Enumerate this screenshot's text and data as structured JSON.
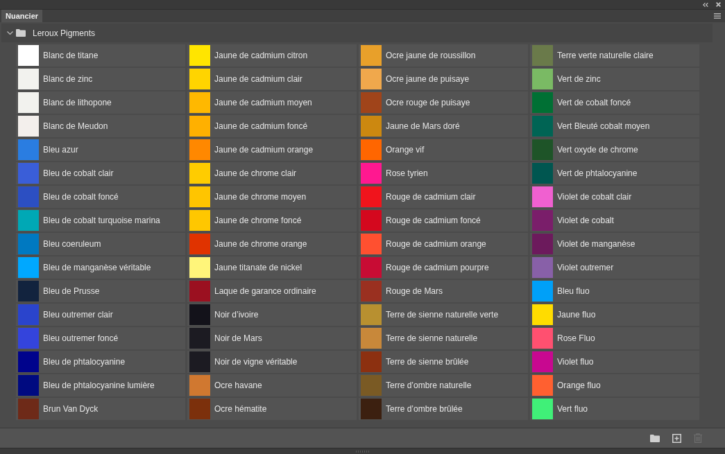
{
  "tabs": [
    {
      "label": "Nuancier",
      "selected": true
    }
  ],
  "group": {
    "name": "Leroux Pigments",
    "expanded": true,
    "swatches": [
      {
        "name": "Blanc de titane",
        "color": "#ffffff"
      },
      {
        "name": "Blanc de zinc",
        "color": "#f2f2ee"
      },
      {
        "name": "Blanc de lithopone",
        "color": "#f2f2ee"
      },
      {
        "name": "Blanc de Meudon",
        "color": "#f3efec"
      },
      {
        "name": "Bleu azur",
        "color": "#2a7de1"
      },
      {
        "name": "Bleu de cobalt clair",
        "color": "#3a5ed8"
      },
      {
        "name": "Bleu de cobalt foncé",
        "color": "#2c4fc2"
      },
      {
        "name": "Bleu de cobalt turquoise marina",
        "color": "#00a8b5"
      },
      {
        "name": "Bleu coeruleum",
        "color": "#0079c1"
      },
      {
        "name": "Bleu de manganèse véritable",
        "color": "#00a8ff"
      },
      {
        "name": "Bleu de Prusse",
        "color": "#12233e"
      },
      {
        "name": "Bleu outremer clair",
        "color": "#2a44cc"
      },
      {
        "name": "Bleu outremer foncé",
        "color": "#3444dc"
      },
      {
        "name": "Bleu de phtalocyanine",
        "color": "#00038c"
      },
      {
        "name": "Bleu de phtalocyanine lumière",
        "color": "#000a80"
      },
      {
        "name": "Brun Van Dyck",
        "color": "#6e2a18"
      },
      {
        "name": "Jaune de cadmium citron",
        "color": "#ffe500"
      },
      {
        "name": "Jaune de cadmium clair",
        "color": "#ffd400"
      },
      {
        "name": "Jaune de cadmium moyen",
        "color": "#ffb800"
      },
      {
        "name": "Jaune de cadmium foncé",
        "color": "#ffb000"
      },
      {
        "name": "Jaune de cadmium orange",
        "color": "#ff8800"
      },
      {
        "name": "Jaune de chrome clair",
        "color": "#ffcc00"
      },
      {
        "name": "Jaune de chrome moyen",
        "color": "#ffc500"
      },
      {
        "name": "Jaune de chrome foncé",
        "color": "#ffc700"
      },
      {
        "name": "Jaune de chrome orange",
        "color": "#e03300"
      },
      {
        "name": "Jaune titanate de nickel",
        "color": "#fff57a"
      },
      {
        "name": "Laque de garance ordinaire",
        "color": "#9b1020"
      },
      {
        "name": "Noir d’ivoire",
        "color": "#13121a"
      },
      {
        "name": "Noir de Mars",
        "color": "#1c1b22"
      },
      {
        "name": "Noir de vigne véritable",
        "color": "#1c1b22"
      },
      {
        "name": "Ocre havane",
        "color": "#d07830"
      },
      {
        "name": "Ocre hématite",
        "color": "#7c300c"
      },
      {
        "name": "Ocre jaune de roussillon",
        "color": "#e8a02a"
      },
      {
        "name": "Ocre jaune de puisaye",
        "color": "#f0a84c"
      },
      {
        "name": "Ocre rouge de puisaye",
        "color": "#a0441a"
      },
      {
        "name": "Jaune de Mars doré",
        "color": "#cc8810"
      },
      {
        "name": "Orange vif",
        "color": "#ff6600"
      },
      {
        "name": "Rose tyrien",
        "color": "#ff1890"
      },
      {
        "name": "Rouge de cadmium clair",
        "color": "#f0141c"
      },
      {
        "name": "Rouge de cadmium foncé",
        "color": "#d4081e"
      },
      {
        "name": "Rouge de cadmium orange",
        "color": "#ff5030"
      },
      {
        "name": "Rouge de cadmium pourpre",
        "color": "#c80c34"
      },
      {
        "name": "Rouge de Mars",
        "color": "#9a3020"
      },
      {
        "name": "Terre de sienne naturelle verte",
        "color": "#b89030"
      },
      {
        "name": "Terre de sienne naturelle",
        "color": "#c8883a"
      },
      {
        "name": "Terre de sienne brûlée",
        "color": "#8c3010"
      },
      {
        "name": "Terre d’ombre naturelle",
        "color": "#7a5a24"
      },
      {
        "name": "Terre d’ombre brûlée",
        "color": "#3c2010"
      },
      {
        "name": "Terre verte naturelle claire",
        "color": "#6a7a4a"
      },
      {
        "name": "Vert de zinc",
        "color": "#7aba64"
      },
      {
        "name": "Vert de cobalt foncé",
        "color": "#007034"
      },
      {
        "name": "Vert Bleuté cobalt moyen",
        "color": "#006454"
      },
      {
        "name": "Vert oxyde de chrome",
        "color": "#1e5428"
      },
      {
        "name": "Vert de phtalocyanine",
        "color": "#005650"
      },
      {
        "name": "Violet de cobalt clair",
        "color": "#f060d0"
      },
      {
        "name": "Violet de cobalt",
        "color": "#7a1e6a"
      },
      {
        "name": "Violet de manganèse",
        "color": "#6c1a5c"
      },
      {
        "name": "Violet outremer",
        "color": "#8860a8"
      },
      {
        "name": "Bleu fluo",
        "color": "#00a0f8"
      },
      {
        "name": "Jaune fluo",
        "color": "#ffdc00"
      },
      {
        "name": "Rose Fluo",
        "color": "#ff5070"
      },
      {
        "name": "Violet fluo",
        "color": "#c80890"
      },
      {
        "name": "Orange fluo",
        "color": "#ff6030"
      },
      {
        "name": "Vert fluo",
        "color": "#40f078"
      }
    ]
  },
  "footer": {
    "delete_disabled": true
  }
}
